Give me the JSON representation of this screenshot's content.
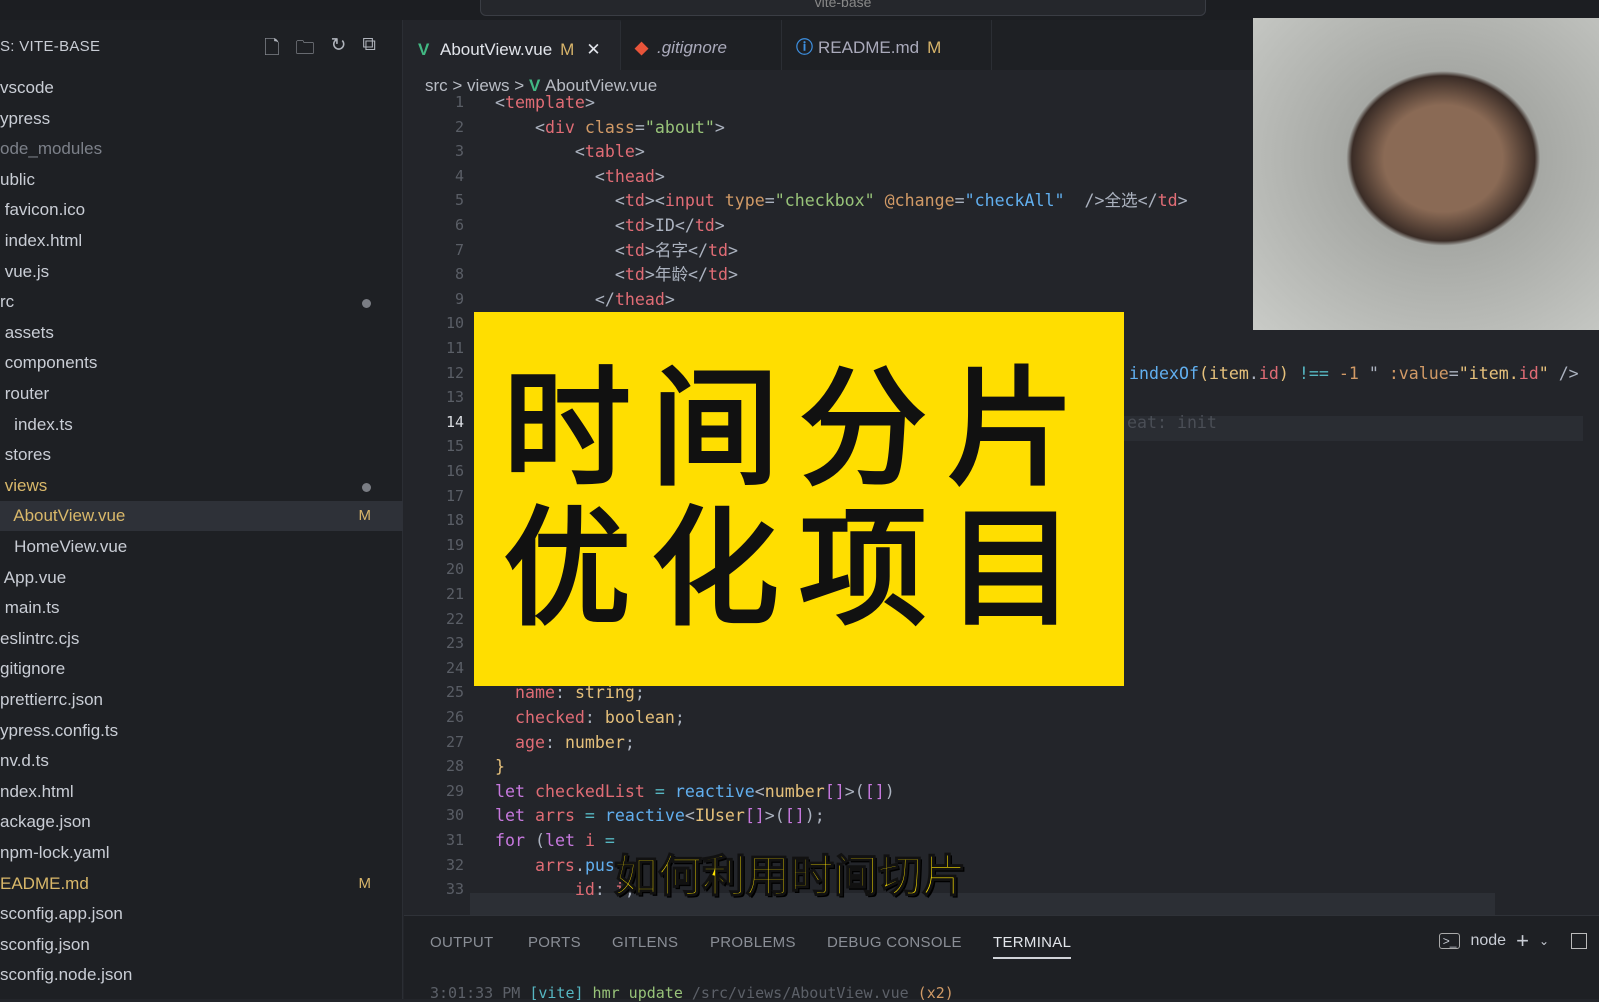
{
  "titlebar": {
    "command_center": "vite-base"
  },
  "sidebar": {
    "header": "S: VITE-BASE",
    "actions": [
      {
        "icon": "new-file-icon",
        "glyph": "🗋"
      },
      {
        "icon": "new-folder-icon",
        "glyph": "🗀"
      },
      {
        "icon": "refresh-icon",
        "glyph": "↻"
      },
      {
        "icon": "collapse-all-icon",
        "glyph": "⧉"
      }
    ],
    "items": [
      {
        "label": "vscode"
      },
      {
        "label": "ypress"
      },
      {
        "label": "ode_modules",
        "dim": true
      },
      {
        "label": "ublic"
      },
      {
        "label": " favicon.ico"
      },
      {
        "label": " index.html"
      },
      {
        "label": " vue.js"
      },
      {
        "label": "rc",
        "dot": true
      },
      {
        "label": " assets"
      },
      {
        "label": " components"
      },
      {
        "label": " router"
      },
      {
        "label": "   index.ts"
      },
      {
        "label": " stores"
      },
      {
        "label": " views",
        "dot": true,
        "mod": true
      },
      {
        "label": "   AboutView.vue",
        "badge": "M",
        "selected": true,
        "mod": true
      },
      {
        "label": "   HomeView.vue"
      },
      {
        "label": " App.vue"
      },
      {
        "label": " main.ts"
      },
      {
        "label": "eslintrc.cjs"
      },
      {
        "label": "gitignore"
      },
      {
        "label": "prettierrc.json"
      },
      {
        "label": "ypress.config.ts"
      },
      {
        "label": "nv.d.ts"
      },
      {
        "label": "ndex.html"
      },
      {
        "label": "ackage.json"
      },
      {
        "label": "npm-lock.yaml"
      },
      {
        "label": "EADME.md",
        "badge": "M",
        "mod": true
      },
      {
        "label": "sconfig.app.json"
      },
      {
        "label": "sconfig.json"
      },
      {
        "label": "sconfig.node.json"
      }
    ]
  },
  "tabs": [
    {
      "label": "AboutView.vue",
      "badge": "M",
      "icon": "vue-icon",
      "glyph": "V",
      "color": "#42b883",
      "active": true,
      "close": "✕"
    },
    {
      "label": ".gitignore",
      "icon": "git-icon",
      "glyph": "◆",
      "color": "#e8543a"
    },
    {
      "label": "README.md",
      "badge": "M",
      "icon": "info-icon",
      "glyph": "ⓘ",
      "color": "#3d8fe0"
    }
  ],
  "breadcrumb": {
    "parts": [
      "src",
      "views",
      "AboutView.vue"
    ],
    "sep": " > "
  },
  "editor": {
    "current_line": 14,
    "line_numbers": [
      1,
      2,
      3,
      4,
      5,
      6,
      7,
      8,
      9,
      10,
      11,
      12,
      13,
      14,
      15,
      16,
      17,
      18,
      19,
      20,
      21,
      22,
      23,
      24,
      25,
      26,
      27,
      28,
      29,
      30,
      31,
      32,
      33
    ],
    "lines": [
      {
        "n": 1,
        "tokens": [
          [
            "<",
            "p"
          ],
          [
            "template",
            "t"
          ],
          [
            ">",
            "p"
          ]
        ]
      },
      {
        "n": 2,
        "tokens": [
          [
            "    <",
            "p"
          ],
          [
            "div",
            "t"
          ],
          [
            " class",
            "a"
          ],
          [
            "=",
            "p"
          ],
          [
            "\"about\"",
            "s"
          ],
          [
            ">",
            "p"
          ]
        ]
      },
      {
        "n": 3,
        "tokens": [
          [
            "        <",
            "p"
          ],
          [
            "table",
            "t"
          ],
          [
            ">",
            "p"
          ]
        ]
      },
      {
        "n": 4,
        "tokens": [
          [
            "          <",
            "p"
          ],
          [
            "thead",
            "t"
          ],
          [
            ">",
            "p"
          ]
        ]
      },
      {
        "n": 5,
        "tokens": [
          [
            "            <",
            "p"
          ],
          [
            "td",
            "t"
          ],
          [
            "><",
            "p"
          ],
          [
            "input",
            "t"
          ],
          [
            " type",
            "a"
          ],
          [
            "=",
            "p"
          ],
          [
            "\"checkbox\"",
            "s"
          ],
          [
            " @change",
            "a"
          ],
          [
            "=",
            "p"
          ],
          [
            "\"checkAll\"",
            "b"
          ],
          [
            "  />全选</",
            "p"
          ],
          [
            "td",
            "t"
          ],
          [
            ">",
            "p"
          ]
        ]
      },
      {
        "n": 6,
        "tokens": [
          [
            "            <",
            "p"
          ],
          [
            "td",
            "t"
          ],
          [
            ">ID</",
            "p"
          ],
          [
            "td",
            "t"
          ],
          [
            ">",
            "p"
          ]
        ]
      },
      {
        "n": 7,
        "tokens": [
          [
            "            <",
            "p"
          ],
          [
            "td",
            "t"
          ],
          [
            ">名字</",
            "p"
          ],
          [
            "td",
            "t"
          ],
          [
            ">",
            "p"
          ]
        ]
      },
      {
        "n": 8,
        "tokens": [
          [
            "            <",
            "p"
          ],
          [
            "td",
            "t"
          ],
          [
            ">年龄</",
            "p"
          ],
          [
            "td",
            "t"
          ],
          [
            ">",
            "p"
          ]
        ]
      },
      {
        "n": 9,
        "tokens": [
          [
            "          </",
            "p"
          ],
          [
            "thead",
            "t"
          ],
          [
            ">",
            "p"
          ]
        ]
      },
      {
        "n": 25,
        "tokens": [
          [
            "  name",
            "t"
          ],
          [
            ": ",
            "p"
          ],
          [
            "string",
            "y"
          ],
          [
            ";",
            "p"
          ]
        ]
      },
      {
        "n": 26,
        "tokens": [
          [
            "  checked",
            "t"
          ],
          [
            ": ",
            "p"
          ],
          [
            "boolean",
            "y"
          ],
          [
            ";",
            "p"
          ]
        ]
      },
      {
        "n": 27,
        "tokens": [
          [
            "  age",
            "t"
          ],
          [
            ": ",
            "p"
          ],
          [
            "number",
            "y"
          ],
          [
            ";",
            "p"
          ]
        ]
      },
      {
        "n": 28,
        "tokens": [
          [
            "}",
            "y"
          ]
        ]
      },
      {
        "n": 29,
        "tokens": [
          [
            "let ",
            "k"
          ],
          [
            "checkedList",
            "t"
          ],
          [
            " = ",
            "c"
          ],
          [
            "reactive",
            "b"
          ],
          [
            "<",
            "p"
          ],
          [
            "number",
            "y"
          ],
          [
            "[]",
            "k"
          ],
          [
            ">(",
            "p"
          ],
          [
            "[]",
            "k"
          ],
          [
            ")",
            "p"
          ]
        ]
      },
      {
        "n": 30,
        "tokens": [
          [
            "let ",
            "k"
          ],
          [
            "arrs",
            "t"
          ],
          [
            " = ",
            "c"
          ],
          [
            "reactive",
            "b"
          ],
          [
            "<",
            "p"
          ],
          [
            "IUser",
            "y"
          ],
          [
            "[]",
            "k"
          ],
          [
            ">(",
            "p"
          ],
          [
            "[]",
            "k"
          ],
          [
            ");",
            "p"
          ]
        ]
      },
      {
        "n": 31,
        "tokens": [
          [
            "for ",
            "k"
          ],
          [
            "(",
            "p"
          ],
          [
            "let ",
            "k"
          ],
          [
            "i ",
            "t"
          ],
          [
            "=",
            "c"
          ]
        ]
      },
      {
        "n": 32,
        "tokens": [
          [
            "    arrs",
            "t"
          ],
          [
            ".",
            "p"
          ],
          [
            "pus",
            "b"
          ]
        ]
      },
      {
        "n": 33,
        "tokens": [
          [
            "        id",
            "t"
          ],
          [
            ": ",
            "p"
          ],
          [
            "i",
            "t"
          ],
          [
            ",",
            "p"
          ]
        ]
      }
    ],
    "line12_tail": [
      [
        "indexOf",
        "b"
      ],
      [
        "(",
        "y"
      ],
      [
        "item",
        "y"
      ],
      [
        ".",
        "p"
      ],
      [
        "id",
        "t"
      ],
      [
        ")",
        "y"
      ],
      [
        " !== ",
        "c"
      ],
      [
        "-1",
        "a"
      ],
      [
        " \" ",
        "p"
      ],
      [
        ":value",
        "a"
      ],
      [
        "=",
        "p"
      ],
      [
        "\"item.",
        "y"
      ],
      [
        "id",
        "t"
      ],
      [
        "\"",
        "y"
      ],
      [
        " />",
        "p"
      ]
    ],
    "line14_ghost": "eat: init"
  },
  "overlay": {
    "title_lines": [
      "时间分片",
      "优化项目"
    ],
    "subtitle": "如何利用时间切片",
    "color": "#ffde00"
  },
  "panel": {
    "tabs": [
      "OUTPUT",
      "PORTS",
      "GITLENS",
      "PROBLEMS",
      "DEBUG CONSOLE",
      "TERMINAL"
    ],
    "active": "TERMINAL",
    "terminal_name": "node",
    "terminal_line": [
      [
        "3:01:33 PM ",
        "g"
      ],
      [
        "[vite]",
        "c"
      ],
      [
        " hmr update ",
        "s"
      ],
      [
        "/src/views/AboutView.vue",
        "g"
      ],
      [
        " (x2)",
        "a"
      ]
    ]
  }
}
